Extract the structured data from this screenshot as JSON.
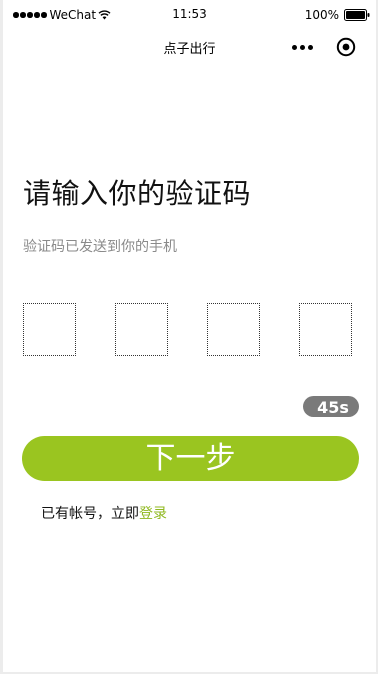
{
  "status_bar": {
    "carrier": "WeChat",
    "time": "11:53",
    "battery": "100%"
  },
  "nav": {
    "title": "点子出行"
  },
  "content": {
    "heading": "请输入你的验证码",
    "subtitle": "验证码已发送到你的手机",
    "code_boxes": [
      "",
      "",
      "",
      ""
    ],
    "countdown": "45s",
    "next_button": "下一步",
    "login_prompt": "已有帐号，立即",
    "login_link": "登录"
  },
  "colors": {
    "accent": "#9ac520",
    "link": "#8fb81f",
    "countdown_bg": "#7a7a7a"
  }
}
